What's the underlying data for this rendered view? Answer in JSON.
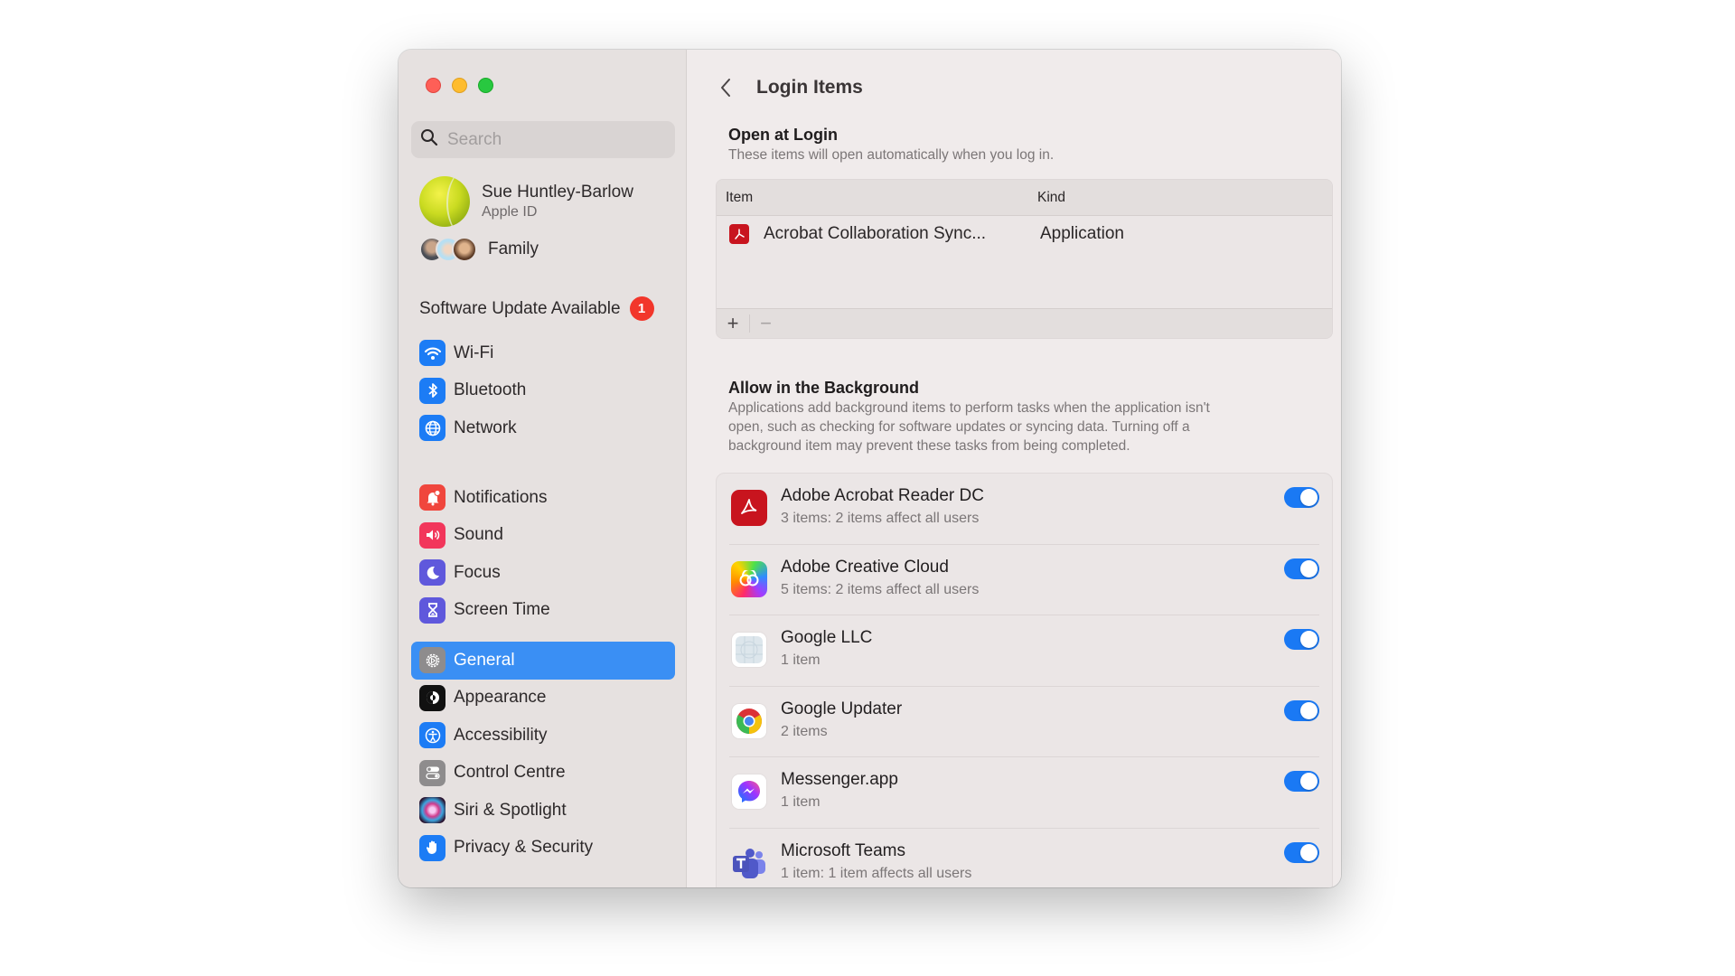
{
  "window": {
    "traffic_lights": [
      "close",
      "minimize",
      "zoom"
    ]
  },
  "sidebar": {
    "search": {
      "placeholder": "Search",
      "value": ""
    },
    "account": {
      "name": "Sue Huntley-Barlow",
      "subtitle": "Apple ID"
    },
    "family": {
      "label": "Family"
    },
    "software_update": {
      "label": "Software Update Available",
      "badge": "1"
    },
    "groups": [
      [
        {
          "label": "Wi-Fi",
          "icon": "wifi-icon",
          "color": "#1c7cf5"
        },
        {
          "label": "Bluetooth",
          "icon": "bluetooth-icon",
          "color": "#1c7cf5"
        },
        {
          "label": "Network",
          "icon": "globe-icon",
          "color": "#1c7cf5"
        }
      ],
      [
        {
          "label": "Notifications",
          "icon": "bell-icon",
          "color": "#f0463d"
        },
        {
          "label": "Sound",
          "icon": "speaker-icon",
          "color": "#f2365b"
        },
        {
          "label": "Focus",
          "icon": "moon-icon",
          "color": "#5f58dc"
        },
        {
          "label": "Screen Time",
          "icon": "hourglass-icon",
          "color": "#5f58dc"
        }
      ],
      [
        {
          "label": "General",
          "icon": "gear-icon",
          "color": "#8e8c8d",
          "selected": true
        },
        {
          "label": "Appearance",
          "icon": "appearance-icon",
          "color": "#111111"
        },
        {
          "label": "Accessibility",
          "icon": "accessibility-icon",
          "color": "#1c7cf5"
        },
        {
          "label": "Control Centre",
          "icon": "switches-icon",
          "color": "#8e8c8d"
        },
        {
          "label": "Siri & Spotlight",
          "icon": "siri-icon",
          "color": "#3c1f44"
        },
        {
          "label": "Privacy & Security",
          "icon": "hand-icon",
          "color": "#1c7cf5"
        }
      ]
    ]
  },
  "main": {
    "title": "Login Items",
    "open_at_login": {
      "title": "Open at Login",
      "description": "These items will open automatically when you log in.",
      "columns": {
        "item": "Item",
        "kind": "Kind"
      },
      "rows": [
        {
          "item": "Acrobat Collaboration Sync...",
          "kind": "Application"
        }
      ],
      "add_label": "+",
      "remove_label": "−"
    },
    "background": {
      "title": "Allow in the Background",
      "description_lines": [
        "Applications add background items to perform tasks when the application isn't",
        "open, such as checking for software updates or syncing data. Turning off a",
        "background item may prevent these tasks from being completed."
      ],
      "items": [
        {
          "name": "Adobe Acrobat Reader DC",
          "detail": "3 items: 2 items affect all users",
          "enabled": true,
          "icon": "acrobat-icon"
        },
        {
          "name": "Adobe Creative Cloud",
          "detail": "5 items: 2 items affect all users",
          "enabled": true,
          "icon": "creative-cloud-icon"
        },
        {
          "name": "Google LLC",
          "detail": "1 item",
          "enabled": true,
          "icon": "generic-app-icon"
        },
        {
          "name": "Google Updater",
          "detail": "2 items",
          "enabled": true,
          "icon": "chrome-icon"
        },
        {
          "name": "Messenger.app",
          "detail": "1 item",
          "enabled": true,
          "icon": "messenger-icon"
        },
        {
          "name": "Microsoft Teams",
          "detail": "1 item: 1 item affects all users",
          "enabled": true,
          "icon": "teams-icon"
        }
      ]
    }
  },
  "colors": {
    "accent": "#3a8ff4",
    "toggle_on": "#1a79f4",
    "badge": "#f2362b"
  }
}
